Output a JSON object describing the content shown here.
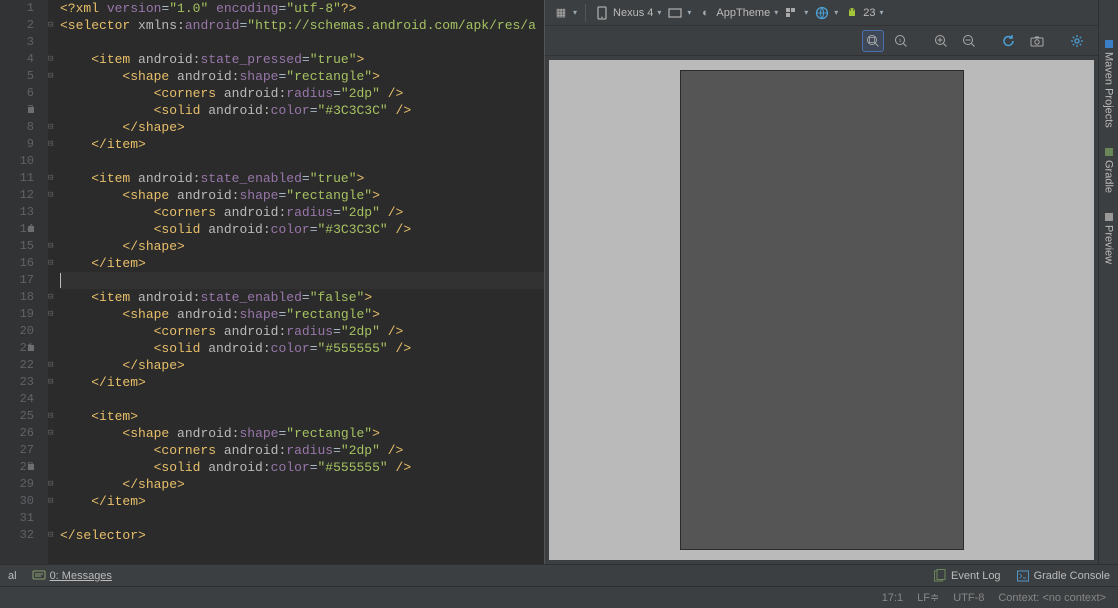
{
  "editor": {
    "lines": [
      {
        "n": 1,
        "html": "<span class='pi'>&lt;?xml</span> <span class='attrname'>version</span>=<span class='val'>\"1.0\"</span> <span class='attrname'>encoding</span>=<span class='val'>\"utf-8\"</span><span class='pi'>?&gt;</span>"
      },
      {
        "n": 2,
        "html": "<span class='tag'>&lt;selector</span> <span class='attrns'>xmlns:</span><span class='attrname'>android</span>=<span class='val'>\"http://schemas.android.com/apk/res/a</span>"
      },
      {
        "n": 3,
        "html": ""
      },
      {
        "n": 4,
        "html": "    <span class='tag'>&lt;item</span> <span class='attrns'>android:</span><span class='attrname'>state_pressed</span>=<span class='val'>\"true\"</span><span class='tag'>&gt;</span>"
      },
      {
        "n": 5,
        "html": "        <span class='tag'>&lt;shape</span> <span class='attrns'>android:</span><span class='attrname'>shape</span>=<span class='val'>\"rectangle\"</span><span class='tag'>&gt;</span>"
      },
      {
        "n": 6,
        "html": "            <span class='tag'>&lt;corners</span> <span class='attrns'>android:</span><span class='attrname'>radius</span>=<span class='val'>\"2dp\"</span> <span class='tag'>/&gt;</span>"
      },
      {
        "n": 7,
        "html": "            <span class='tag'>&lt;solid</span> <span class='attrns'>android:</span><span class='attrname'>color</span>=<span class='val'>\"#3C3C3C\"</span> <span class='tag'>/&gt;</span>"
      },
      {
        "n": 8,
        "html": "        <span class='tag'>&lt;/shape&gt;</span>"
      },
      {
        "n": 9,
        "html": "    <span class='tag'>&lt;/item&gt;</span>"
      },
      {
        "n": 10,
        "html": ""
      },
      {
        "n": 11,
        "html": "    <span class='tag'>&lt;item</span> <span class='attrns'>android:</span><span class='attrname'>state_enabled</span>=<span class='val'>\"true\"</span><span class='tag'>&gt;</span>"
      },
      {
        "n": 12,
        "html": "        <span class='tag'>&lt;shape</span> <span class='attrns'>android:</span><span class='attrname'>shape</span>=<span class='val'>\"rectangle\"</span><span class='tag'>&gt;</span>"
      },
      {
        "n": 13,
        "html": "            <span class='tag'>&lt;corners</span> <span class='attrns'>android:</span><span class='attrname'>radius</span>=<span class='val'>\"2dp\"</span> <span class='tag'>/&gt;</span>"
      },
      {
        "n": 14,
        "html": "            <span class='tag'>&lt;solid</span> <span class='attrns'>android:</span><span class='attrname'>color</span>=<span class='val'>\"#3C3C3C\"</span> <span class='tag'>/&gt;</span>"
      },
      {
        "n": 15,
        "html": "        <span class='tag'>&lt;/shape&gt;</span>"
      },
      {
        "n": 16,
        "html": "    <span class='tag'>&lt;/item&gt;</span>"
      },
      {
        "n": 17,
        "html": "<span class='caret'></span>",
        "current": true
      },
      {
        "n": 18,
        "html": "    <span class='tag'>&lt;item</span> <span class='attrns'>android:</span><span class='attrname'>state_enabled</span>=<span class='val'>\"false\"</span><span class='tag'>&gt;</span>"
      },
      {
        "n": 19,
        "html": "        <span class='tag'>&lt;shape</span> <span class='attrns'>android:</span><span class='attrname'>shape</span>=<span class='val'>\"rectangle\"</span><span class='tag'>&gt;</span>"
      },
      {
        "n": 20,
        "html": "            <span class='tag'>&lt;corners</span> <span class='attrns'>android:</span><span class='attrname'>radius</span>=<span class='val'>\"2dp\"</span> <span class='tag'>/&gt;</span>"
      },
      {
        "n": 21,
        "html": "            <span class='tag'>&lt;solid</span> <span class='attrns'>android:</span><span class='attrname'>color</span>=<span class='val'>\"#555555\"</span> <span class='tag'>/&gt;</span>"
      },
      {
        "n": 22,
        "html": "        <span class='tag'>&lt;/shape&gt;</span>"
      },
      {
        "n": 23,
        "html": "    <span class='tag'>&lt;/item&gt;</span>"
      },
      {
        "n": 24,
        "html": ""
      },
      {
        "n": 25,
        "html": "    <span class='tag'>&lt;item&gt;</span>"
      },
      {
        "n": 26,
        "html": "        <span class='tag'>&lt;shape</span> <span class='attrns'>android:</span><span class='attrname'>shape</span>=<span class='val'>\"rectangle\"</span><span class='tag'>&gt;</span>"
      },
      {
        "n": 27,
        "html": "            <span class='tag'>&lt;corners</span> <span class='attrns'>android:</span><span class='attrname'>radius</span>=<span class='val'>\"2dp\"</span> <span class='tag'>/&gt;</span>"
      },
      {
        "n": 28,
        "html": "            <span class='tag'>&lt;solid</span> <span class='attrns'>android:</span><span class='attrname'>color</span>=<span class='val'>\"#555555\"</span> <span class='tag'>/&gt;</span>"
      },
      {
        "n": 29,
        "html": "        <span class='tag'>&lt;/shape&gt;</span>"
      },
      {
        "n": 30,
        "html": "    <span class='tag'>&lt;/item&gt;</span>"
      },
      {
        "n": 31,
        "html": ""
      },
      {
        "n": 32,
        "html": "<span class='tag'>&lt;/selector&gt;</span>"
      }
    ],
    "markers_at": [
      7,
      14,
      21,
      28
    ]
  },
  "preview_toolbar": {
    "device": "Nexus 4",
    "theme": "AppTheme",
    "api": "23"
  },
  "right_panels": [
    "Maven Projects",
    "Gradle",
    "Preview"
  ],
  "bottom_toolbar": {
    "left_partial": "al",
    "messages": "0: Messages",
    "event_log": "Event Log",
    "gradle_console": "Gradle Console"
  },
  "status_bar": {
    "pos": "17:1",
    "sep": "LF",
    "enc": "UTF-8",
    "context": "Context: <no context>"
  }
}
